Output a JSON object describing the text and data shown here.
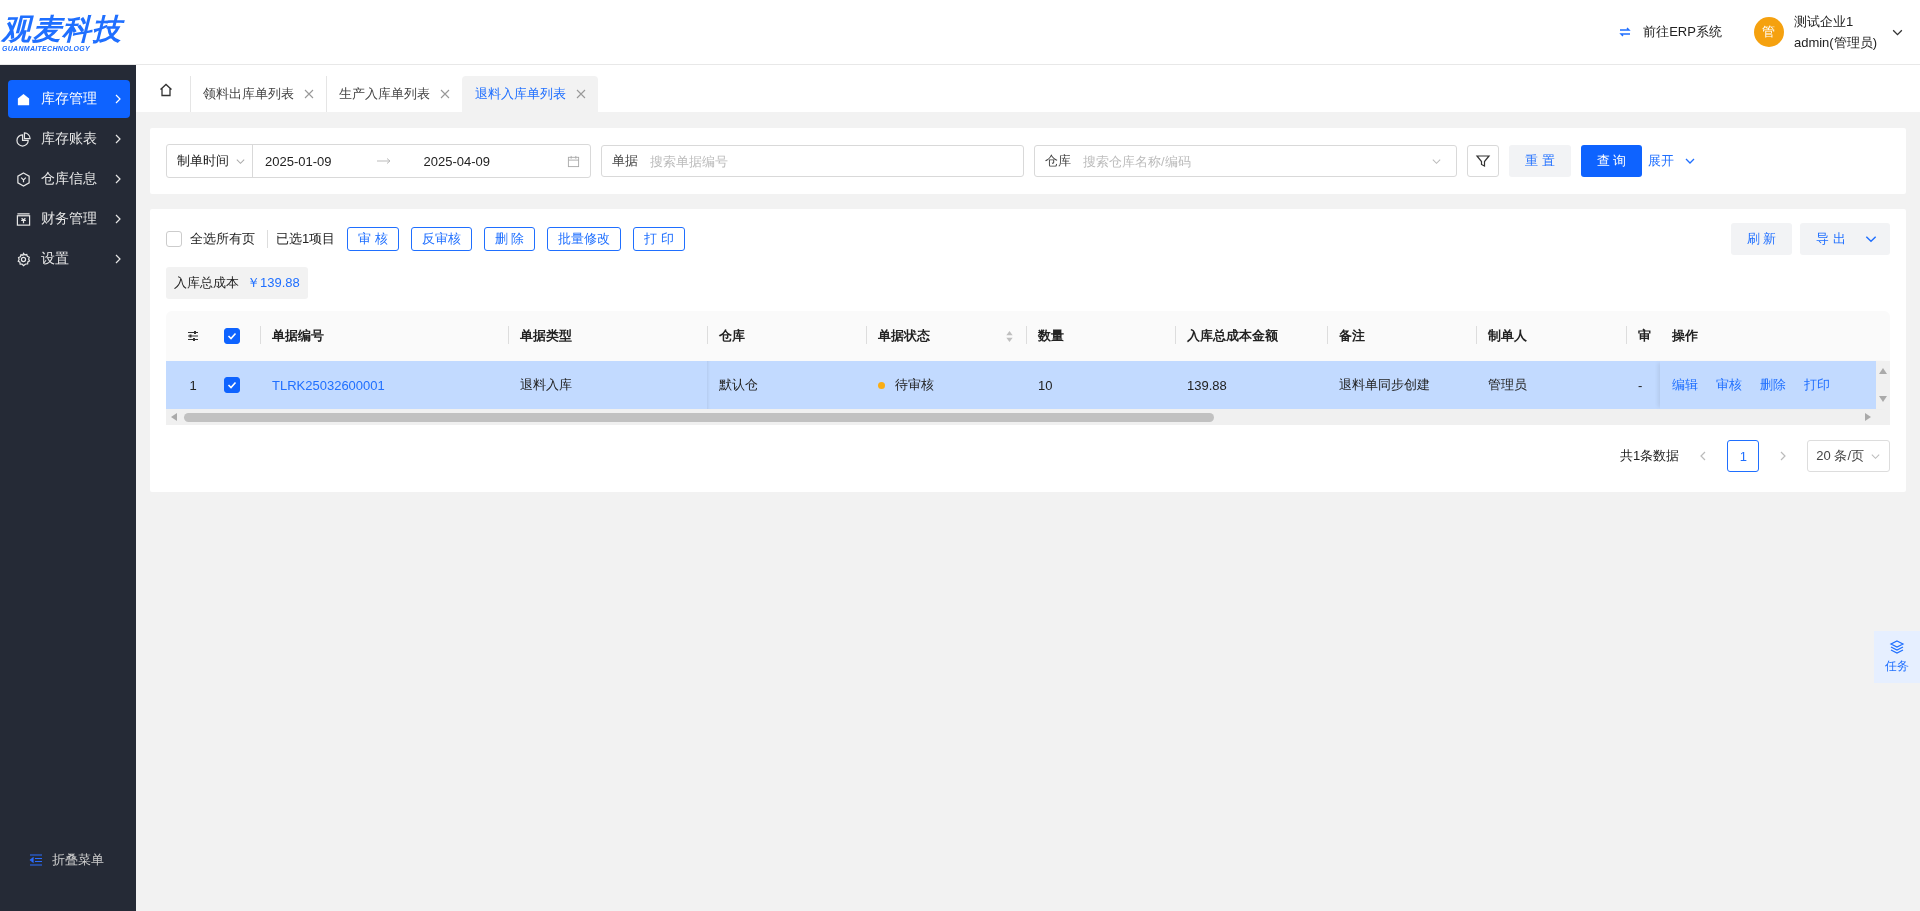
{
  "logo": {
    "text": "观麦科技",
    "subtitle": "GUANMAITECHNOLOGY"
  },
  "header": {
    "erp_link": "前往ERP系统",
    "user": {
      "avatar": "管",
      "company": "测试企业1",
      "role": "admin(管理员)"
    }
  },
  "sidebar": {
    "items": [
      {
        "label": "库存管理",
        "selected": true
      },
      {
        "label": "库存账表",
        "selected": false
      },
      {
        "label": "仓库信息",
        "selected": false
      },
      {
        "label": "财务管理",
        "selected": false
      },
      {
        "label": "设置",
        "selected": false
      }
    ],
    "collapse": "折叠菜单"
  },
  "tabs": [
    {
      "label": "领料出库单列表",
      "selected": false
    },
    {
      "label": "生产入库单列表",
      "selected": false
    },
    {
      "label": "退料入库单列表",
      "selected": true
    }
  ],
  "filters": {
    "date_type": "制单时间",
    "start_date": "2025-01-09",
    "end_date": "2025-04-09",
    "document": {
      "label": "单据",
      "placeholder": "搜索单据编号"
    },
    "warehouse": {
      "label": "仓库",
      "placeholder": "搜索仓库名称/编码"
    },
    "reset": "重 置",
    "query": "查 询",
    "expand": "展开"
  },
  "toolbar": {
    "select_all": {
      "label": "全选所有页",
      "checked": false
    },
    "selected_count": "已选1项目",
    "actions": [
      "审 核",
      "反审核",
      "删 除",
      "批量修改",
      "打 印"
    ],
    "refresh": "刷 新",
    "export": "导 出"
  },
  "summary": {
    "label": "入库总成本",
    "value": "￥139.88"
  },
  "table": {
    "header_checked": true,
    "columns": [
      "单据编号",
      "单据类型",
      "仓库",
      "单据状态",
      "数量",
      "入库总成本金额",
      "备注",
      "制单人",
      "审",
      "操作"
    ],
    "rows": [
      {
        "index": "1",
        "selected": true,
        "code": "TLRK25032600001",
        "type": "退料入库",
        "warehouse": "默认仓",
        "status": {
          "text": "待审核",
          "color": "#faad14"
        },
        "quantity": "10",
        "cost": "139.88",
        "note": "退料单同步创建",
        "maker": "管理员",
        "auditor": "-",
        "actions": [
          "编辑",
          "审核",
          "删除",
          "打印"
        ]
      }
    ]
  },
  "pagination": {
    "total": "共1条数据",
    "pages": [
      {
        "label": "1",
        "selected": true
      }
    ],
    "page_size": "20 条/页"
  },
  "task_button": "任务"
}
